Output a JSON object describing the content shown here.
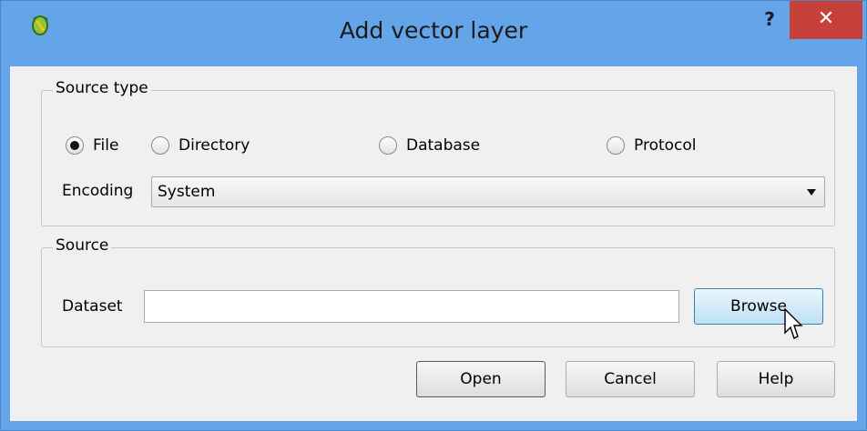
{
  "window": {
    "title": "Add vector layer",
    "help_label": "?",
    "close_label": "✕"
  },
  "source_type": {
    "title": "Source type",
    "options": [
      {
        "label": "File",
        "selected": true
      },
      {
        "label": "Directory",
        "selected": false
      },
      {
        "label": "Database",
        "selected": false
      },
      {
        "label": "Protocol",
        "selected": false
      }
    ],
    "encoding_label": "Encoding",
    "encoding_value": "System"
  },
  "source": {
    "title": "Source",
    "dataset_label": "Dataset",
    "dataset_value": "",
    "browse_label": "Browse"
  },
  "buttons": {
    "open": "Open",
    "cancel": "Cancel",
    "help": "Help"
  },
  "colors": {
    "titlebar": "#64a4e8",
    "close": "#c7413a",
    "dialog": "#f0f0f0"
  }
}
